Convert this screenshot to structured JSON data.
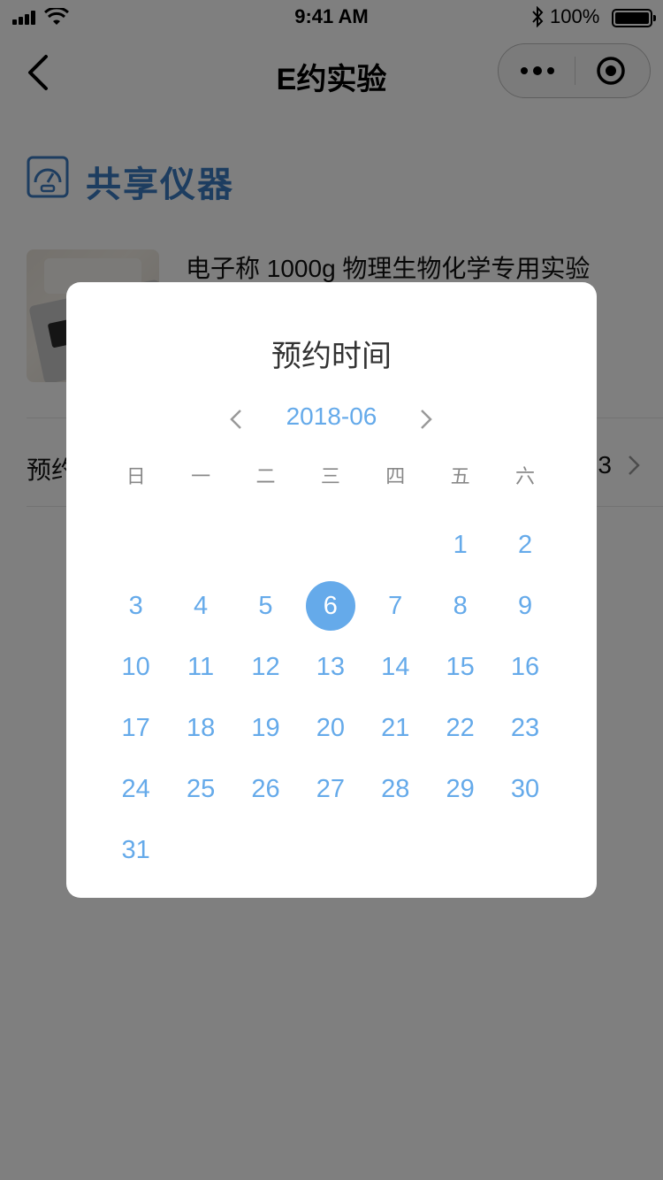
{
  "status_bar": {
    "time": "9:41 AM",
    "battery_pct": "100%"
  },
  "nav": {
    "title": "E约实验",
    "icons": [
      "back-icon",
      "more-icon",
      "target-icon"
    ]
  },
  "section": {
    "title": "共享仪器",
    "icon": "gauge-icon"
  },
  "product": {
    "name": "电子称 1000g 物理生物化学专用实验"
  },
  "booking_row": {
    "label": "预约",
    "value": "3",
    "icon": "chevron-right-icon"
  },
  "dialog": {
    "title": "预约时间",
    "month": "2018-06",
    "weekdays": [
      "日",
      "一",
      "二",
      "三",
      "四",
      "五",
      "六"
    ],
    "first_weekday_index": 5,
    "days": [
      "1",
      "2",
      "3",
      "4",
      "5",
      "6",
      "7",
      "8",
      "9",
      "10",
      "11",
      "12",
      "13",
      "14",
      "15",
      "16",
      "17",
      "18",
      "19",
      "20",
      "21",
      "22",
      "23",
      "24",
      "25",
      "26",
      "27",
      "28",
      "29",
      "30",
      "31"
    ],
    "selected_day": "6"
  },
  "colors": {
    "accent": "#65aaea",
    "section_blue": "#3b7bc0",
    "mask": "rgba(0,0,0,0.5)"
  }
}
